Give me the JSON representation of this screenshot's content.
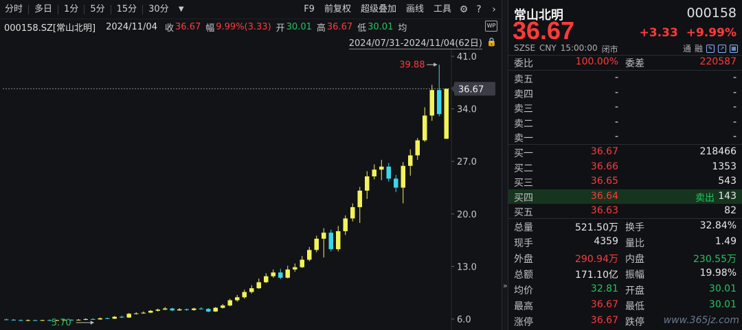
{
  "toolbar": {
    "periods": [
      "分时",
      "多日",
      "1分",
      "5分",
      "15分",
      "30分"
    ],
    "right_items": [
      "F9",
      "前复权",
      "超级叠加",
      "画线",
      "工具"
    ]
  },
  "info": {
    "code_name": "000158.SZ[常山北明]",
    "date": "2024/11/04",
    "close_label": "收",
    "close": "36.67",
    "change_label": "幅",
    "change": "9.99%(3.33)",
    "open_label": "开",
    "open": "30.01",
    "high_label": "高",
    "high": "36.67",
    "low_label": "低",
    "low": "30.01",
    "avg_label": "均"
  },
  "range": "2024/07/31-2024/11/04(62日)",
  "chart_data": {
    "type": "candlestick",
    "y_ticks": [
      "41.0",
      "34.0",
      "27.0",
      "20.0",
      "13.0",
      "6.0"
    ],
    "ylim": [
      6.0,
      41.0
    ],
    "last_price_label": "36.67",
    "max_label": "39.88",
    "min_label": "5.70",
    "candles": [
      [
        5.95,
        5.9,
        6.05,
        5.85
      ],
      [
        5.9,
        5.85,
        6.0,
        5.8
      ],
      [
        5.85,
        5.8,
        5.95,
        5.75
      ],
      [
        5.8,
        5.85,
        5.95,
        5.7
      ],
      [
        5.85,
        5.8,
        5.9,
        5.75
      ],
      [
        5.8,
        5.85,
        5.9,
        5.75
      ],
      [
        5.85,
        5.8,
        5.95,
        5.75
      ],
      [
        5.8,
        5.85,
        5.9,
        5.75
      ],
      [
        5.85,
        5.9,
        6.0,
        5.8
      ],
      [
        5.9,
        5.85,
        5.95,
        5.8
      ],
      [
        5.85,
        5.9,
        6.0,
        5.8
      ],
      [
        5.9,
        6.0,
        6.1,
        5.85
      ],
      [
        6.0,
        5.95,
        6.1,
        5.9
      ],
      [
        5.95,
        6.1,
        6.2,
        5.9
      ],
      [
        6.1,
        6.05,
        6.2,
        6.0
      ],
      [
        6.05,
        6.3,
        6.4,
        6.0
      ],
      [
        6.3,
        6.2,
        6.45,
        6.15
      ],
      [
        6.2,
        6.7,
        6.8,
        6.15
      ],
      [
        6.7,
        6.75,
        6.9,
        6.6
      ],
      [
        6.75,
        6.85,
        7.0,
        6.7
      ],
      [
        6.85,
        7.1,
        7.2,
        6.8
      ],
      [
        7.1,
        7.25,
        7.4,
        7.0
      ],
      [
        7.25,
        7.4,
        7.6,
        7.2
      ],
      [
        7.4,
        7.15,
        7.5,
        7.05
      ],
      [
        7.15,
        7.3,
        7.45,
        7.1
      ],
      [
        7.3,
        7.2,
        7.4,
        7.1
      ],
      [
        7.2,
        7.4,
        7.5,
        7.1
      ],
      [
        7.4,
        7.35,
        7.55,
        7.25
      ],
      [
        7.35,
        7.0,
        7.45,
        6.9
      ],
      [
        7.0,
        7.5,
        7.6,
        6.95
      ],
      [
        7.5,
        7.8,
        8.0,
        7.4
      ],
      [
        7.8,
        8.5,
        8.7,
        7.7
      ],
      [
        8.5,
        8.9,
        9.2,
        8.3
      ],
      [
        8.9,
        9.6,
        9.9,
        8.7
      ],
      [
        9.6,
        10.1,
        10.5,
        9.4
      ],
      [
        10.1,
        10.9,
        11.4,
        10.0
      ],
      [
        10.9,
        11.7,
        12.1,
        10.8
      ],
      [
        11.7,
        12.2,
        12.6,
        11.5
      ],
      [
        12.2,
        11.5,
        12.7,
        11.3
      ],
      [
        11.5,
        12.6,
        13.1,
        11.4
      ],
      [
        12.6,
        12.9,
        13.4,
        12.3
      ],
      [
        12.9,
        13.9,
        14.4,
        12.8
      ],
      [
        13.9,
        15.2,
        15.6,
        13.7
      ],
      [
        15.2,
        16.7,
        17.1,
        14.9
      ],
      [
        16.7,
        17.5,
        18.1,
        14.2
      ],
      [
        17.5,
        15.3,
        17.9,
        15.0
      ],
      [
        15.3,
        17.7,
        18.4,
        15.0
      ],
      [
        17.7,
        19.4,
        19.8,
        17.2
      ],
      [
        19.4,
        20.9,
        21.4,
        19.0
      ],
      [
        20.9,
        23.1,
        23.6,
        18.8
      ],
      [
        23.1,
        25.0,
        25.7,
        22.0
      ],
      [
        25.0,
        25.9,
        26.6,
        24.6
      ],
      [
        25.9,
        26.3,
        27.2,
        24.5
      ],
      [
        26.3,
        24.7,
        26.8,
        24.3
      ],
      [
        24.7,
        23.5,
        25.2,
        22.9
      ],
      [
        23.5,
        26.4,
        26.9,
        21.4
      ],
      [
        26.4,
        27.8,
        28.6,
        25.1
      ],
      [
        27.8,
        29.8,
        30.1,
        27.2
      ],
      [
        29.8,
        33.1,
        34.2,
        29.6
      ],
      [
        33.1,
        36.5,
        37.2,
        32.4
      ],
      [
        36.5,
        33.3,
        39.88,
        33.0
      ],
      [
        30.01,
        36.67,
        36.67,
        30.01
      ]
    ]
  },
  "quote": {
    "name": "常山北明",
    "code": "000158",
    "price": "36.67",
    "change": "+3.33",
    "change_pct": "+9.99%",
    "market": "SZSE",
    "currency": "CNY",
    "time": "15:00:00",
    "status": "闭市",
    "flag1": "通",
    "flag2": "融",
    "weibi_label": "委比",
    "weibi": "100.00%",
    "weicha_label": "委差",
    "weicha": "220587",
    "asks": [
      {
        "label": "卖五",
        "price": "-",
        "vol": "-"
      },
      {
        "label": "卖四",
        "price": "-",
        "vol": "-"
      },
      {
        "label": "卖三",
        "price": "-",
        "vol": "-"
      },
      {
        "label": "卖二",
        "price": "-",
        "vol": "-"
      },
      {
        "label": "卖一",
        "price": "-",
        "vol": "-"
      }
    ],
    "bids": [
      {
        "label": "买一",
        "price": "36.67",
        "vol": "218466"
      },
      {
        "label": "买二",
        "price": "36.66",
        "vol": "1353"
      },
      {
        "label": "买三",
        "price": "36.65",
        "vol": "543"
      },
      {
        "label": "买四",
        "price": "36.64",
        "vol": "143",
        "tag": "卖出"
      },
      {
        "label": "买五",
        "price": "36.63",
        "vol": "82"
      }
    ],
    "stats": [
      {
        "l1": "总量",
        "v1": "521.50万",
        "l2": "换手",
        "v2": "32.84%",
        "c1": "white",
        "c2": "white"
      },
      {
        "l1": "现手",
        "v1": "4359",
        "l2": "量比",
        "v2": "1.49",
        "c1": "white",
        "c2": "white"
      },
      {
        "l1": "外盘",
        "v1": "290.94万",
        "l2": "内盘",
        "v2": "230.55万",
        "c1": "red",
        "c2": "green"
      },
      {
        "l1": "总额",
        "v1": "171.10亿",
        "l2": "振幅",
        "v2": "19.98%",
        "c1": "white",
        "c2": "white"
      },
      {
        "l1": "均价",
        "v1": "32.81",
        "l2": "开盘",
        "v2": "30.01",
        "c1": "green",
        "c2": "green"
      },
      {
        "l1": "最高",
        "v1": "36.67",
        "l2": "最低",
        "v2": "30.01",
        "c1": "red",
        "c2": "green"
      },
      {
        "l1": "涨停",
        "v1": "36.67",
        "l2": "跌停",
        "v2": "",
        "c1": "red",
        "c2": "white"
      }
    ]
  },
  "watermark": "www.365jz.com",
  "colors": {
    "up": "#ff3b3b",
    "down": "#22c55e",
    "candle_up": "#f2f25a",
    "candle_down": "#3ad6e8"
  }
}
